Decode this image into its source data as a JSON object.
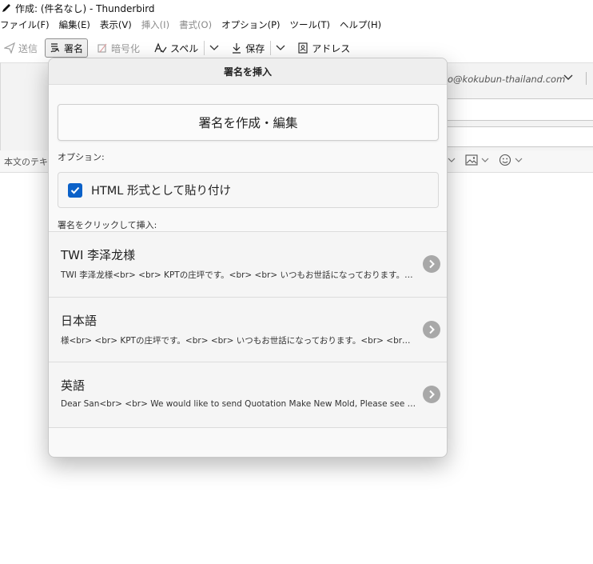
{
  "window": {
    "title": "作成: (件名なし) - Thunderbird"
  },
  "menu": [
    {
      "label": "ファイル(F)",
      "disabled": false
    },
    {
      "label": "編集(E)",
      "disabled": false
    },
    {
      "label": "表示(V)",
      "disabled": false
    },
    {
      "label": "挿入(I)",
      "disabled": true
    },
    {
      "label": "書式(O)",
      "disabled": true
    },
    {
      "label": "オプション(P)",
      "disabled": false
    },
    {
      "label": "ツール(T)",
      "disabled": false
    },
    {
      "label": "ヘルプ(H)",
      "disabled": false
    }
  ],
  "toolbar": {
    "send": "送信",
    "signature": "署名",
    "encrypt": "暗号化",
    "spell": "スペル",
    "save": "保存",
    "address": "アドレス"
  },
  "compose": {
    "from_partial": "o@kokubun-thailand.com",
    "paragraph_partial": "本文のテキスト"
  },
  "panel": {
    "title": "署名を挿入",
    "create_button": "署名を作成・編集",
    "options_label": "オプション:",
    "html_option": "HTML 形式として貼り付け",
    "html_checked": true,
    "click_label": "署名をクリックして挿入:",
    "signatures": [
      {
        "name": "TWI 李泽龙様",
        "preview": "TWI 李泽龙様<br> <br> KPTの庄坪です。<br> <br> いつもお世話になっております。<br> <br>"
      },
      {
        "name": "日本語",
        "preview": "様<br> <br> KPTの庄坪です。<br> <br> いつもお世話になっております。<br> <br> 宜しくお願いします。"
      },
      {
        "name": "英語",
        "preview": "Dear San<br> <br> We would like to send Quotation Make New Mold, Please see detail below."
      }
    ]
  },
  "colors": {
    "accent": "#0b61c8",
    "arrow": "#a8a8a8"
  }
}
